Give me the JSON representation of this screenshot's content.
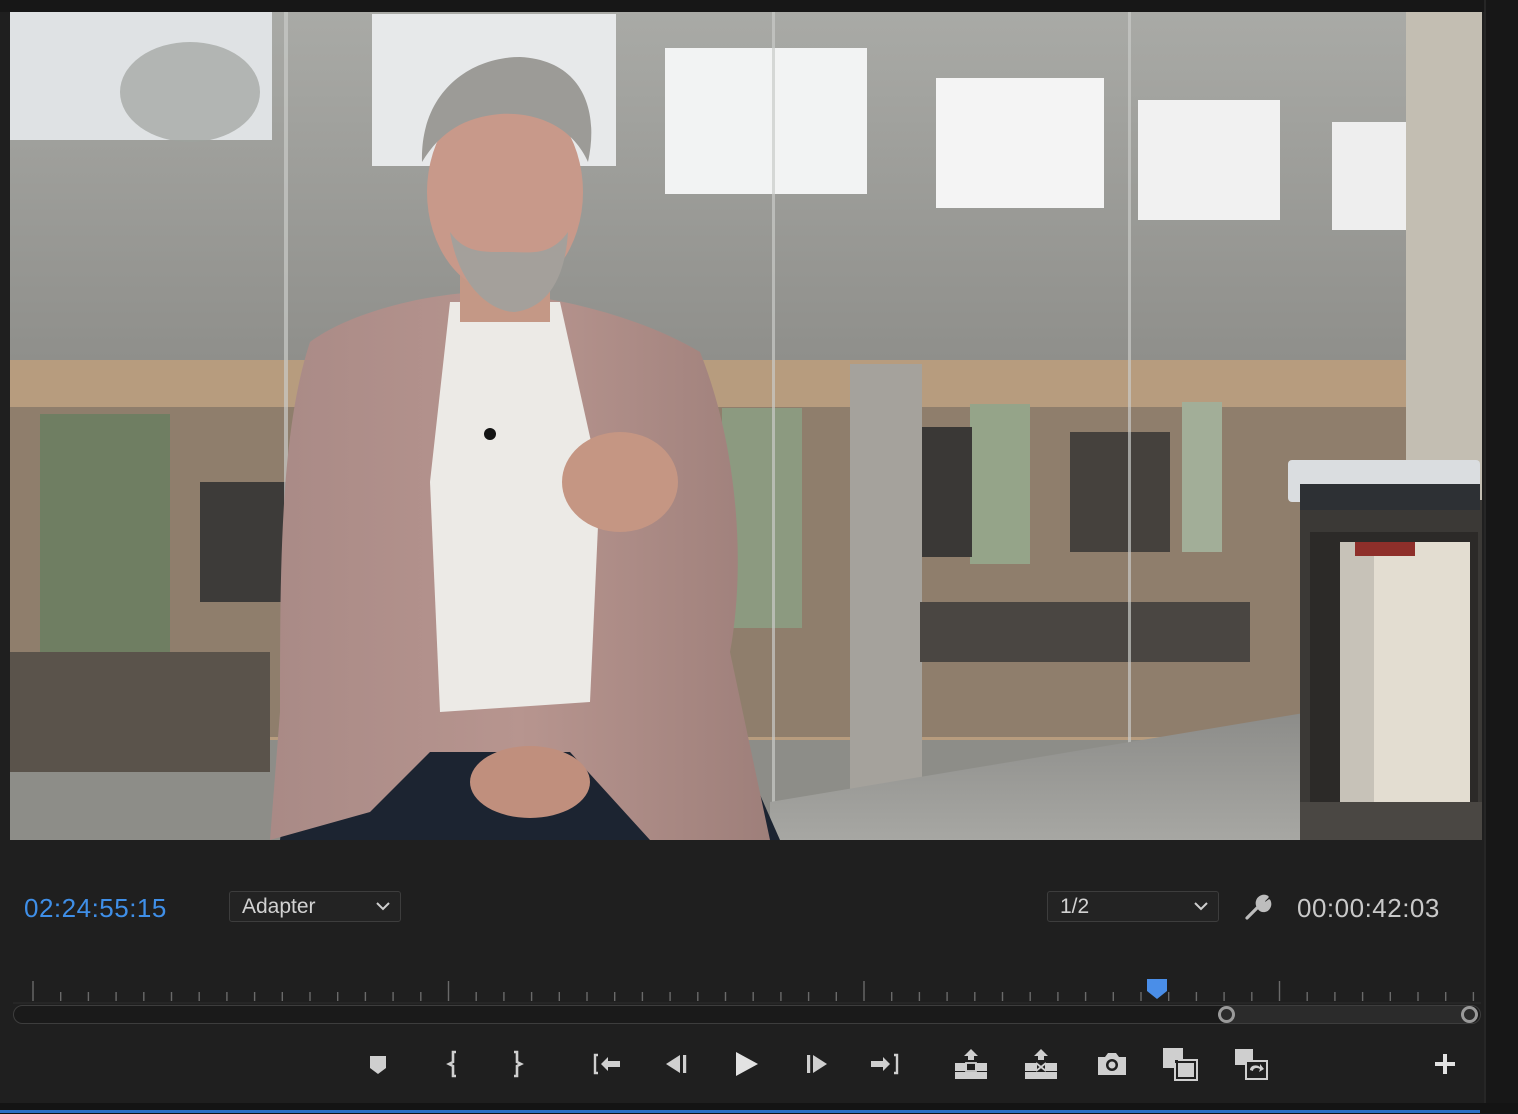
{
  "monitor": {
    "current_timecode": "02:24:55:15",
    "duration_timecode": "00:00:42:03",
    "fit_select": {
      "value": "Adapter"
    },
    "resolution_select": {
      "value": "1/2"
    }
  },
  "colors": {
    "timecode_accent": "#3f8fe8",
    "playhead": "#4a8ee8",
    "panel_bg": "#1f1f1f"
  },
  "timeline": {
    "playhead_position": 0.78,
    "in_point_position": 0.828,
    "out_point_position": 0.994
  },
  "transport": [
    {
      "name": "add-marker-icon"
    },
    {
      "name": "mark-in-icon"
    },
    {
      "name": "mark-out-icon"
    },
    {
      "name": "go-to-in-icon"
    },
    {
      "name": "step-back-icon"
    },
    {
      "name": "play-icon"
    },
    {
      "name": "step-forward-icon"
    },
    {
      "name": "go-to-out-icon"
    },
    {
      "name": "lift-icon"
    },
    {
      "name": "extract-icon"
    },
    {
      "name": "export-frame-camera-icon"
    },
    {
      "name": "comparison-view-icon"
    },
    {
      "name": "toggle-proxies-icon"
    },
    {
      "name": "button-editor-plus-icon"
    }
  ]
}
